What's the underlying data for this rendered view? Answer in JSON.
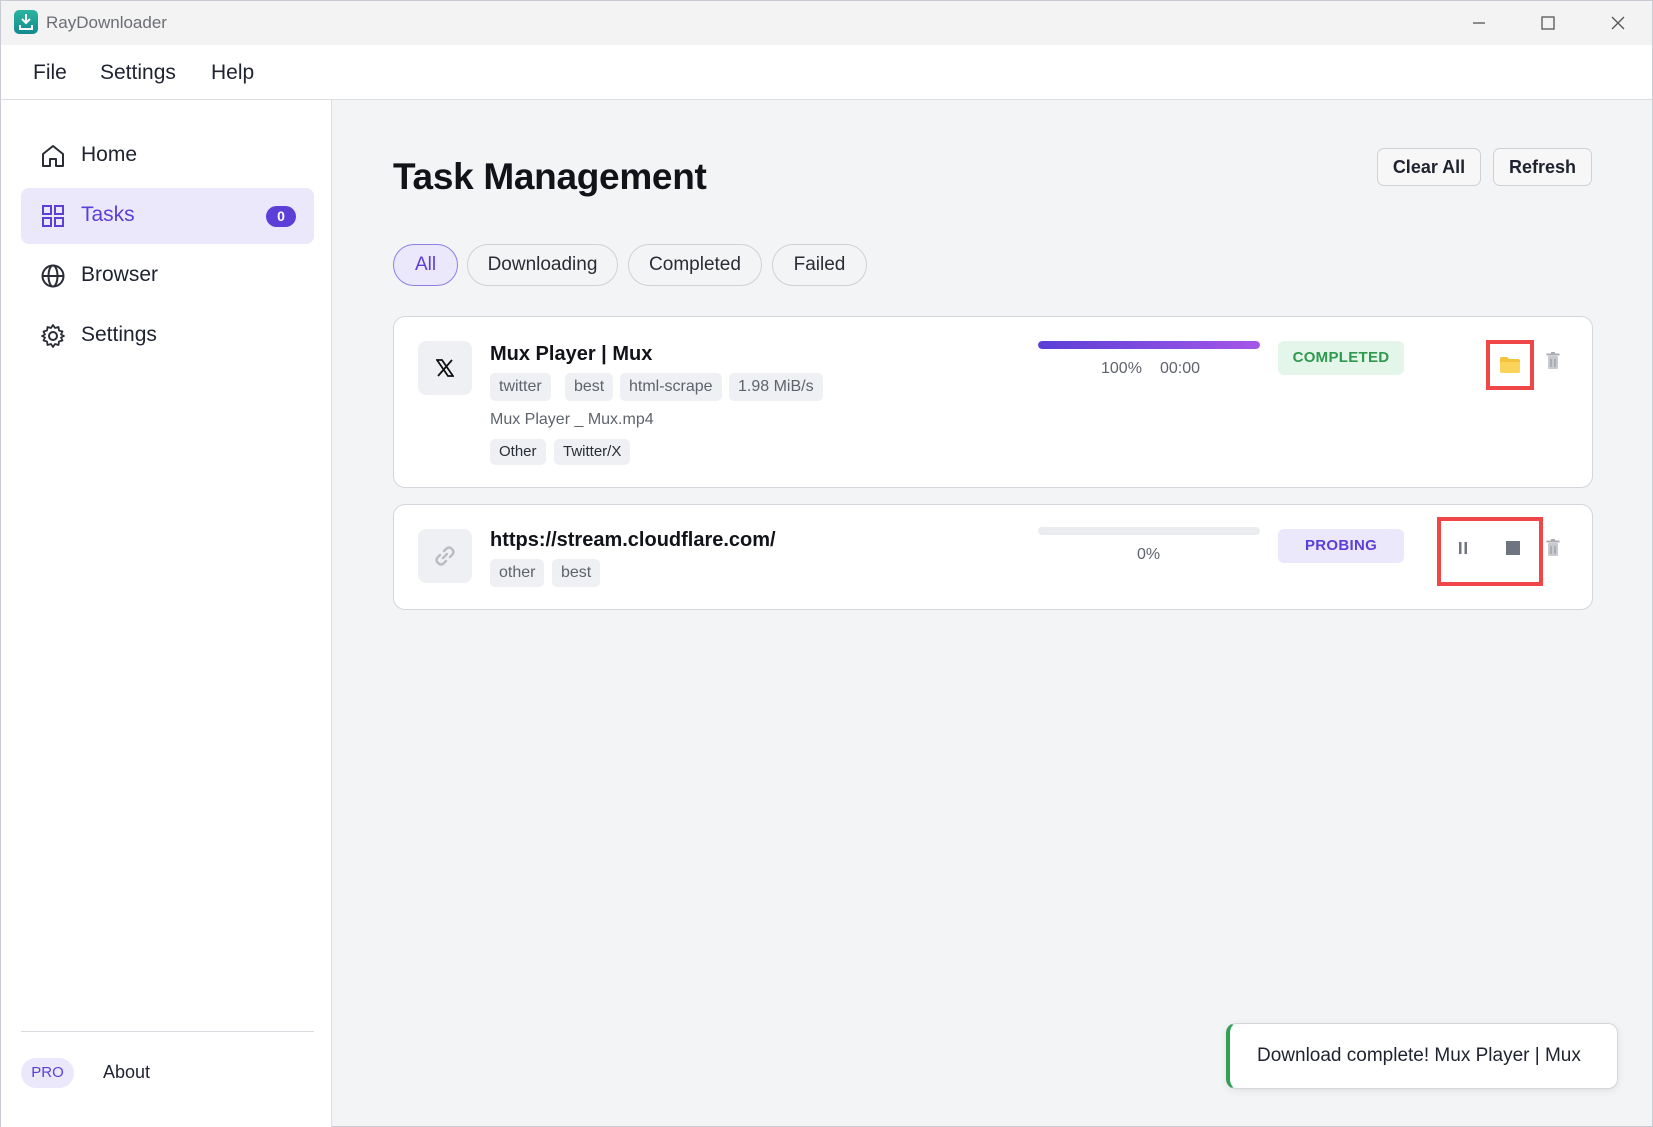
{
  "app": {
    "title": "RayDownloader"
  },
  "menu": {
    "items": [
      "File",
      "Settings",
      "Help"
    ]
  },
  "sidebar": {
    "items": [
      {
        "label": "Home",
        "icon": "home-icon"
      },
      {
        "label": "Tasks",
        "icon": "grid-icon",
        "badge": "0",
        "active": true
      },
      {
        "label": "Browser",
        "icon": "globe-icon"
      },
      {
        "label": "Settings",
        "icon": "gear-icon"
      }
    ],
    "pro_label": "PRO",
    "about_label": "About"
  },
  "main": {
    "title": "Task Management",
    "clear_all_label": "Clear All",
    "refresh_label": "Refresh",
    "filters": [
      "All",
      "Downloading",
      "Completed",
      "Failed"
    ],
    "active_filter": "All"
  },
  "tasks": [
    {
      "icon": "x-logo-icon",
      "title": "Mux Player | Mux",
      "tags": [
        "twitter",
        "best",
        "html-scrape",
        "1.98 MiB/s"
      ],
      "filename": "Mux Player _ Mux.mp4",
      "sub_tags": [
        "Other",
        "Twitter/X"
      ],
      "progress_percent": 100,
      "progress_label": "100%",
      "time_label": "00:00",
      "status": "COMPLETED",
      "actions": [
        "open-folder",
        "delete"
      ]
    },
    {
      "icon": "link-icon",
      "title": "https://stream.cloudflare.com/",
      "tags": [
        "other",
        "best"
      ],
      "progress_percent": 0,
      "progress_label": "0%",
      "status": "PROBING",
      "actions": [
        "pause",
        "stop",
        "delete"
      ]
    }
  ],
  "toast": {
    "message": "Download complete! Mux Player | Mux"
  },
  "colors": {
    "accent": "#5b3fd6",
    "success": "#2f9a4f",
    "highlight": "#ef4747"
  }
}
